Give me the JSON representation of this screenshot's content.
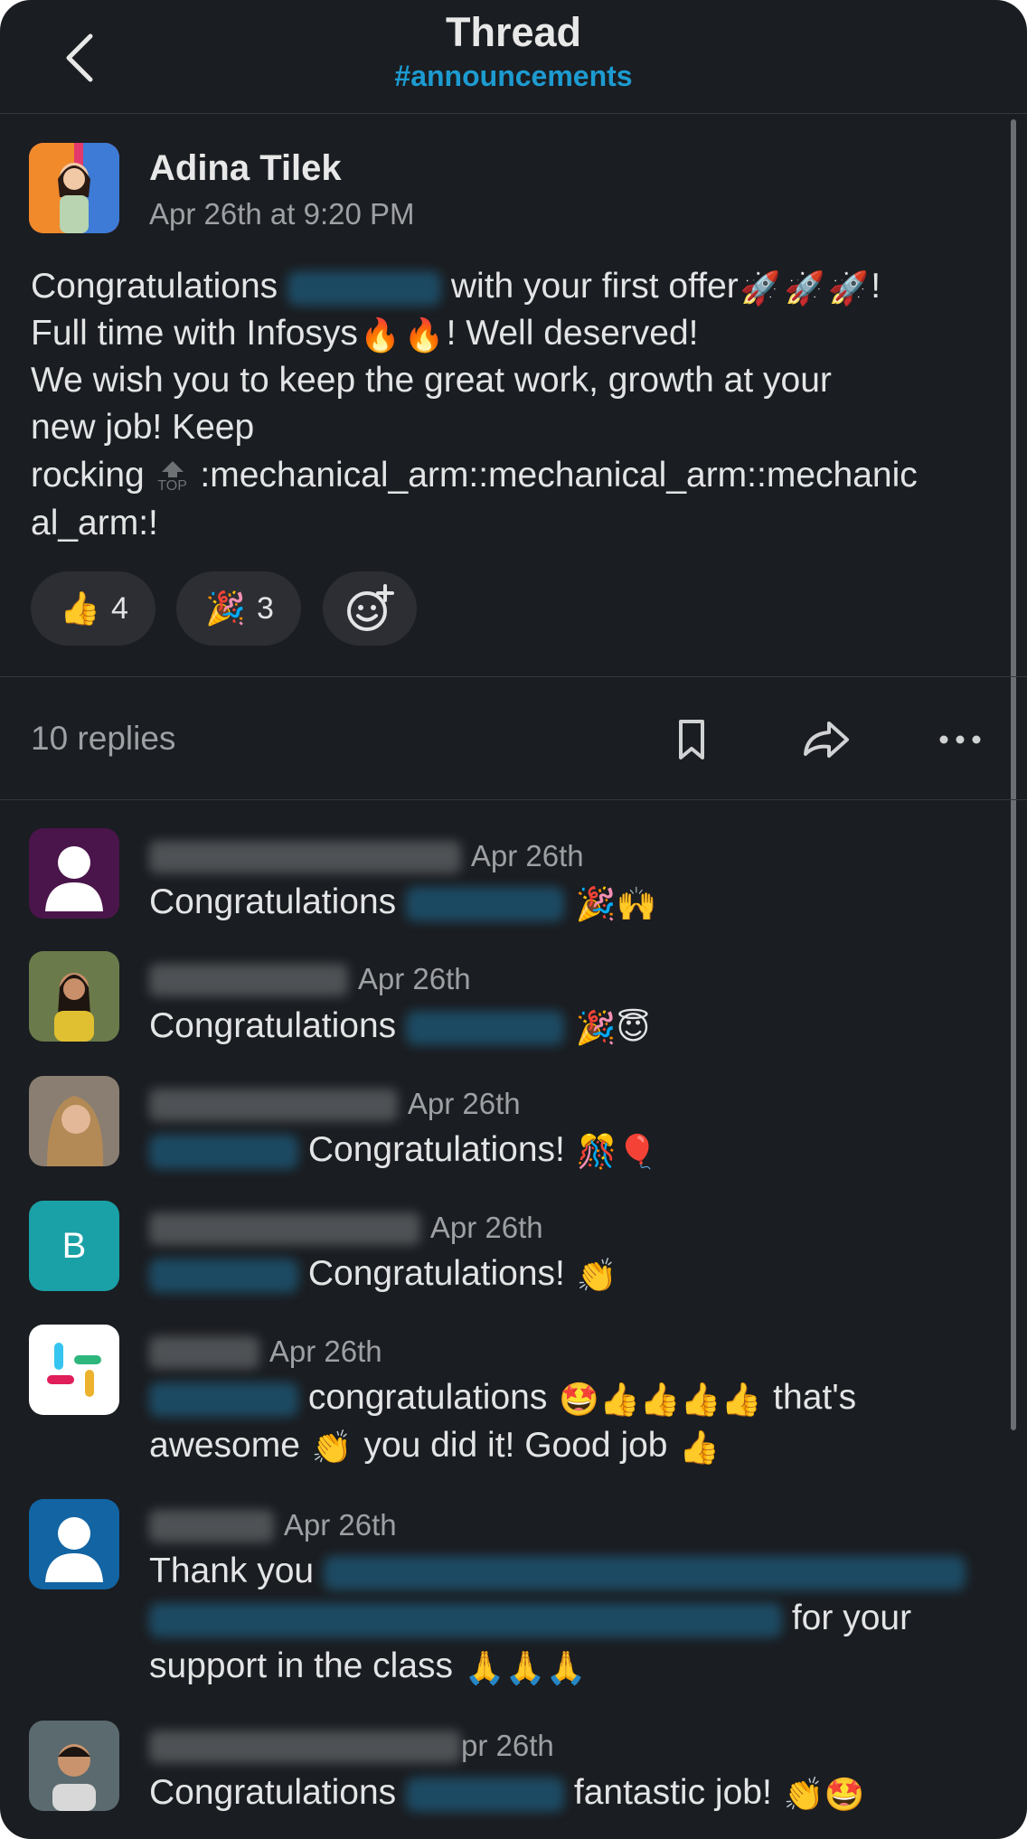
{
  "header": {
    "title": "Thread",
    "channel": "#announcements"
  },
  "parent": {
    "author": "Adina Tilek",
    "time": "Apr 26th at 9:20 PM",
    "lines": [
      "Congratulations",
      "with your first offer",
      "!",
      "Full time with Infosys",
      "! Well deserved!",
      "We wish you to keep the great work, growth at your",
      "new job! Keep",
      "rocking",
      ":mechanical_arm::mechanical_arm::mechanic",
      "al_arm:!"
    ],
    "top_badge": "TOP"
  },
  "reactions": [
    {
      "emoji": "👍",
      "count": "4"
    },
    {
      "emoji": "🎉",
      "count": "3"
    }
  ],
  "thread_bar": {
    "replies": "10 replies"
  },
  "replies": [
    {
      "time": "Apr 26th",
      "text": "Congratulations",
      "emoji": "🎉🙌"
    },
    {
      "time": "Apr 26th",
      "text": "Congratulations",
      "emoji": "🎉😇"
    },
    {
      "time": "Apr 26th",
      "text": "Congratulations!",
      "emoji": "🎊🎈"
    },
    {
      "time": "Apr 26th",
      "text": "Congratulations!",
      "emoji": "👏",
      "avatar_letter": "B"
    },
    {
      "time": "Apr 26th",
      "text": "congratulations",
      "emoji": "🤩👍👍👍👍",
      "tail": "that's",
      "line2a": "awesome",
      "line2emoji": "👏",
      "line2b": "you did it! Good job",
      "line2end": "👍"
    },
    {
      "time": "Apr 26th",
      "text": "Thank you",
      "line2": "for your",
      "line3": "support in the class",
      "line3emoji": "🙏🙏🙏"
    },
    {
      "time": "pr 26th",
      "text": "Congratulations",
      "tail": "fantastic job!",
      "emoji": "👏🤩"
    }
  ],
  "colors": {
    "background": "#1a1d21",
    "channel": "#1d9bd1",
    "reaction_bg": "#2c2e33"
  }
}
